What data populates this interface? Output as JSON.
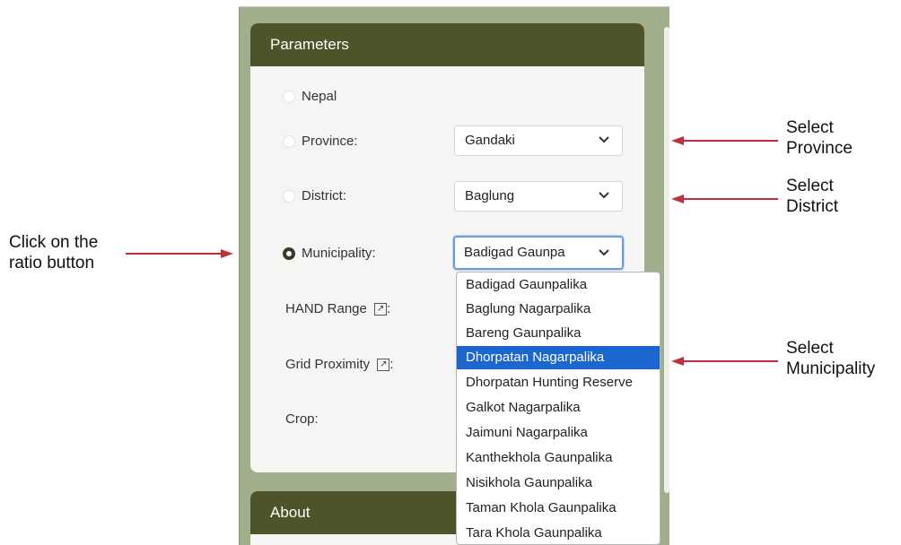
{
  "parameters_panel": {
    "title": "Parameters",
    "options": {
      "nepal": "Nepal",
      "province": "Province:",
      "district": "District:",
      "municipality": "Municipality:"
    },
    "selected_option": "municipality",
    "province_select_value": "Gandaki",
    "district_select_value": "Baglung",
    "municipality_select_value": "Badigad Gaunpa",
    "hand_range_label": "HAND Range",
    "grid_proximity_label": "Grid Proximity",
    "crop_label": "Crop:",
    "label_colon": ":",
    "external_link_glyph": "↗"
  },
  "municipality_dropdown": {
    "options": [
      "Badigad Gaunpalika",
      "Baglung Nagarpalika",
      "Bareng Gaunpalika",
      "Dhorpatan Nagarpalika",
      "Dhorpatan Hunting Reserve",
      "Galkot Nagarpalika",
      "Jaimuni Nagarpalika",
      "Kanthekhola Gaunpalika",
      "Nisikhola Gaunpalika",
      "Taman Khola Gaunpalika",
      "Tara Khola Gaunpalika"
    ],
    "highlighted": "Dhorpatan Nagarpalika"
  },
  "about_panel": {
    "title": "About"
  },
  "annotations": {
    "select_province": [
      "Select",
      "Province"
    ],
    "select_district": [
      "Select",
      "District"
    ],
    "select_municipality": [
      "Select",
      "Municipality"
    ],
    "click_radio": [
      "Click on the",
      "ratio button"
    ]
  },
  "colors": {
    "header_bg": "#4e5429",
    "frame_bg": "#a0ae8c",
    "highlight": "#1c66d0",
    "arrow": "#c0303a"
  }
}
